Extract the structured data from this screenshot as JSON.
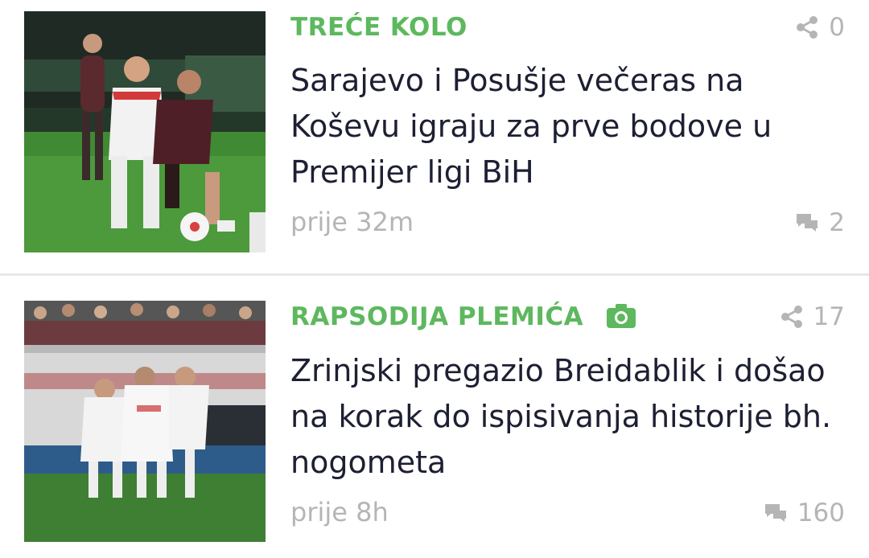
{
  "articles": [
    {
      "category": "TREĆE KOLO",
      "share_count": "0",
      "headline": "Sarajevo i Posušje večeras na Koševu igraju za prve bodove u Premijer ligi BiH",
      "time": "prije 32m",
      "comment_count": "2",
      "icons": {
        "share": "share-icon",
        "comments": "comments-icon"
      }
    },
    {
      "category": "RAPSODIJA PLEMIĆA",
      "has_gallery": true,
      "share_count": "17",
      "headline": "Zrinjski pregazio Breidablik i došao na korak do ispisivanja historije bh. nogometa",
      "time": "prije 8h",
      "comment_count": "160",
      "icons": {
        "gallery": "camera-icon",
        "share": "share-icon",
        "comments": "comments-icon"
      }
    }
  ],
  "colors": {
    "category": "#5db85e",
    "headline": "#1d1f33",
    "meta": "#b5b5b5",
    "divider": "#e7e7e7"
  }
}
